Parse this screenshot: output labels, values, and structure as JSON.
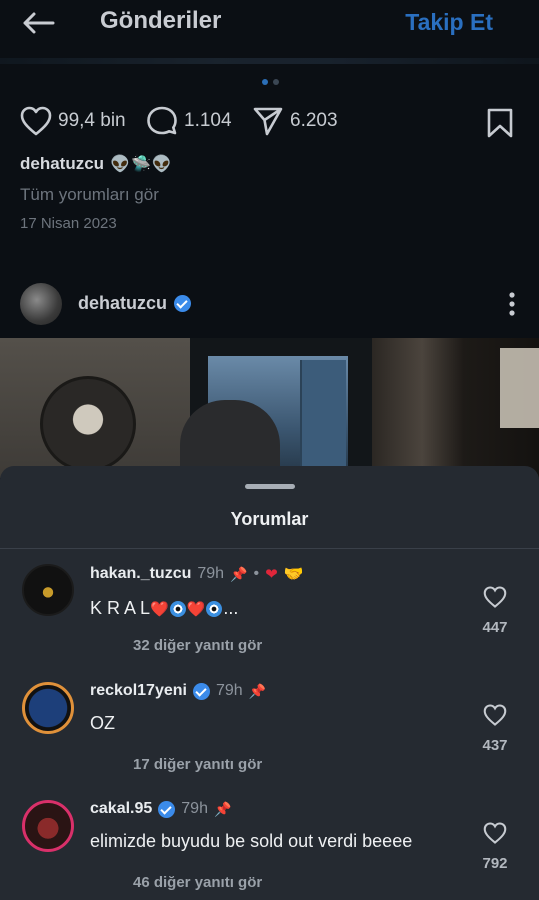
{
  "header": {
    "title": "Gönderiler",
    "follow_label": "Takip Et"
  },
  "post": {
    "likes": "99,4 bin",
    "comments": "1.104",
    "shares": "6.203",
    "username": "dehatuzcu",
    "username_emojis": "👽🛸👽",
    "view_all_comments": "Tüm yorumları gör",
    "date": "17 Nisan 2023"
  },
  "next_post": {
    "username": "dehatuzcu"
  },
  "comments_sheet": {
    "title": "Yorumlar",
    "comments": [
      {
        "username": "hakan._tuzcu",
        "time": "79h",
        "separator": "•",
        "extra_emojis": "🤝",
        "text_prefix": "K R A L",
        "text_suffix": "...",
        "replies": "32 diğer yanıtı gör",
        "likes": "447"
      },
      {
        "username": "reckol17yeni",
        "time": "79h",
        "text": "OZ",
        "replies": "17 diğer yanıtı gör",
        "likes": "437"
      },
      {
        "username": "cakal.95",
        "time": "79h",
        "text": "elimizde buyudu be sold out verdi beeee",
        "replies": "46 diğer yanıtı gör",
        "likes": "792"
      }
    ]
  },
  "colors": {
    "accent_blue": "#2a6fc0",
    "verified_blue": "#3b8bea",
    "sheet_bg": "#252a31",
    "page_bg": "#0b0f14"
  },
  "icons": {
    "back": "arrow-left-icon",
    "like": "heart-icon",
    "comment": "comment-bubble-icon",
    "share": "paper-plane-icon",
    "save": "bookmark-icon",
    "more": "more-vertical-icon",
    "pin": "pin-icon",
    "verified": "verified-badge-icon"
  }
}
